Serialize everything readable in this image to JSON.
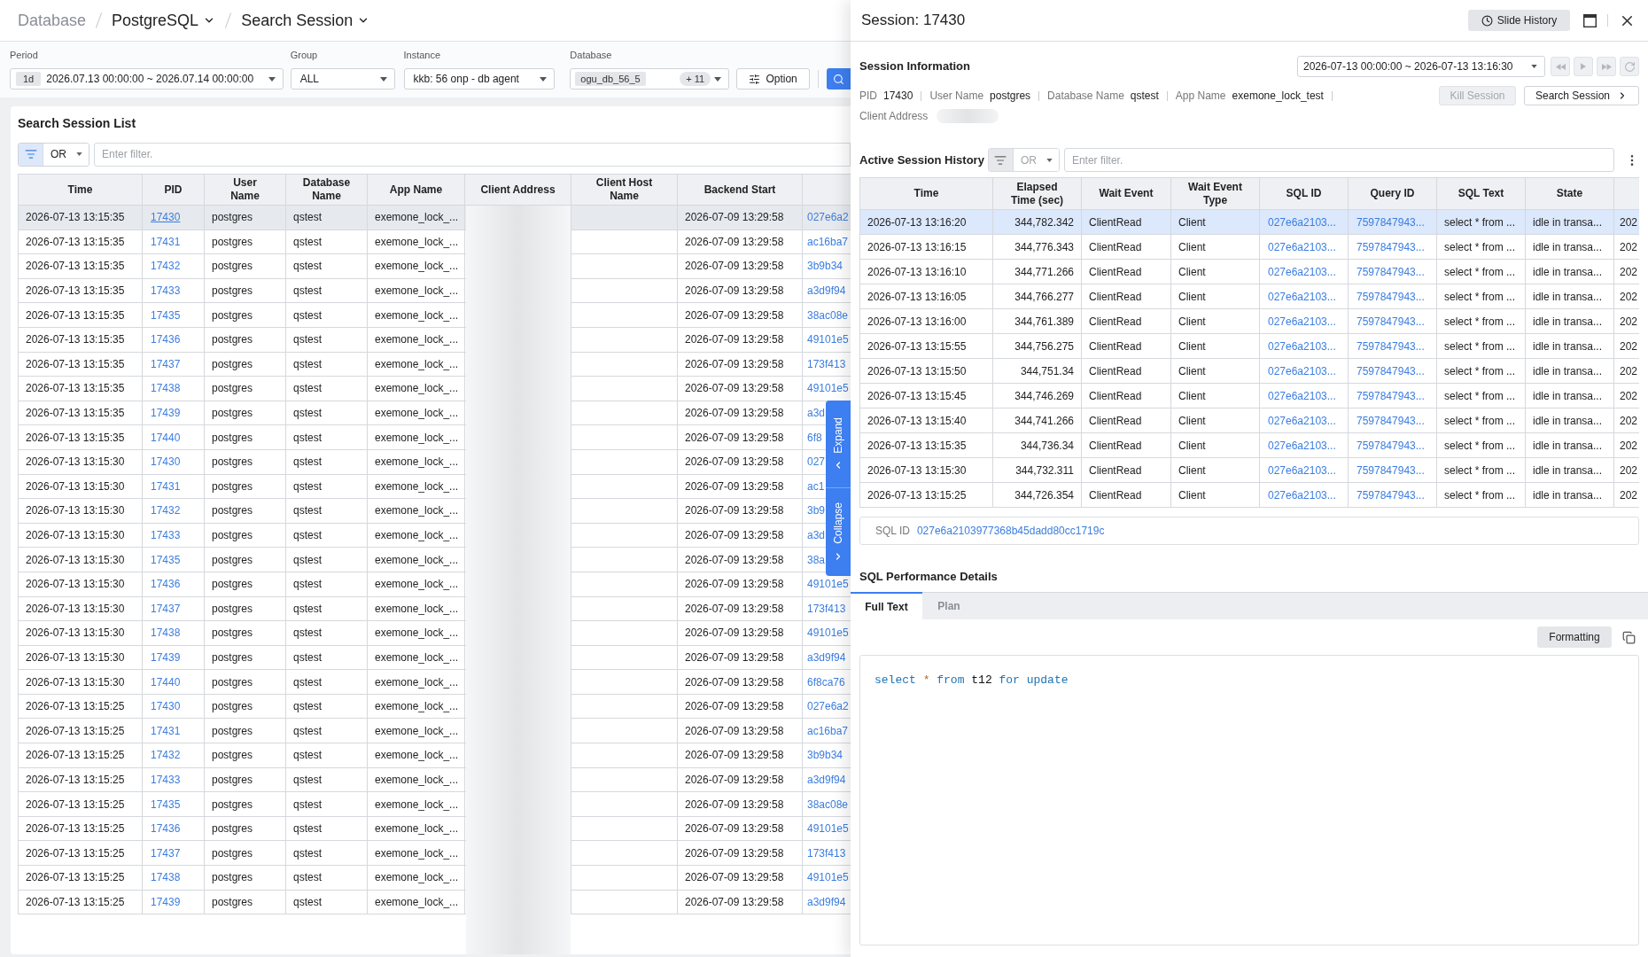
{
  "breadcrumb": [
    {
      "label": "Database",
      "dropdown": false
    },
    {
      "label": "PostgreSQL",
      "dropdown": true
    },
    {
      "label": "Search Session",
      "dropdown": true
    }
  ],
  "filters": {
    "period": {
      "label": "Period",
      "badge": "1d",
      "value": "2026.07.13 00:00:00 ~ 2026.07.14 00:00:00"
    },
    "group": {
      "label": "Group",
      "value": "ALL"
    },
    "instance": {
      "label": "Instance",
      "value": "kkb: 56 onp - db agent"
    },
    "database": {
      "label": "Database",
      "chip": "ogu_db_56_5",
      "more": "+ 11"
    },
    "option": "Option"
  },
  "session_list": {
    "title": "Search Session List",
    "filter": {
      "operator": "OR",
      "placeholder": "Enter filter.",
      "disabled": false
    },
    "columns": [
      "Time",
      "PID",
      "User Name",
      "Database Name",
      "App Name",
      "Client Address",
      "Client Host Name",
      "Backend Start"
    ],
    "rows": [
      {
        "time": "2026-07-13 13:15:35",
        "pid": "17430",
        "user_name": "postgres",
        "database_name": "qstest",
        "app_name": "exemone_lock_...",
        "backend_start": "2026-07-09 13:29:58",
        "column_9": "027e6a2",
        "selected": true
      },
      {
        "time": "2026-07-13 13:15:35",
        "pid": "17431",
        "user_name": "postgres",
        "database_name": "qstest",
        "app_name": "exemone_lock_...",
        "backend_start": "2026-07-09 13:29:58",
        "column_9": "ac16ba7",
        "selected": false
      },
      {
        "time": "2026-07-13 13:15:35",
        "pid": "17432",
        "user_name": "postgres",
        "database_name": "qstest",
        "app_name": "exemone_lock_...",
        "backend_start": "2026-07-09 13:29:58",
        "column_9": "3b9b34",
        "selected": false
      },
      {
        "time": "2026-07-13 13:15:35",
        "pid": "17433",
        "user_name": "postgres",
        "database_name": "qstest",
        "app_name": "exemone_lock_...",
        "backend_start": "2026-07-09 13:29:58",
        "column_9": "a3d9f94",
        "selected": false
      },
      {
        "time": "2026-07-13 13:15:35",
        "pid": "17435",
        "user_name": "postgres",
        "database_name": "qstest",
        "app_name": "exemone_lock_...",
        "backend_start": "2026-07-09 13:29:58",
        "column_9": "38ac08e",
        "selected": false
      },
      {
        "time": "2026-07-13 13:15:35",
        "pid": "17436",
        "user_name": "postgres",
        "database_name": "qstest",
        "app_name": "exemone_lock_...",
        "backend_start": "2026-07-09 13:29:58",
        "column_9": "49101e5",
        "selected": false
      },
      {
        "time": "2026-07-13 13:15:35",
        "pid": "17437",
        "user_name": "postgres",
        "database_name": "qstest",
        "app_name": "exemone_lock_...",
        "backend_start": "2026-07-09 13:29:58",
        "column_9": "173f413",
        "selected": false
      },
      {
        "time": "2026-07-13 13:15:35",
        "pid": "17438",
        "user_name": "postgres",
        "database_name": "qstest",
        "app_name": "exemone_lock_...",
        "backend_start": "2026-07-09 13:29:58",
        "column_9": "49101e5",
        "selected": false
      },
      {
        "time": "2026-07-13 13:15:35",
        "pid": "17439",
        "user_name": "postgres",
        "database_name": "qstest",
        "app_name": "exemone_lock_...",
        "backend_start": "2026-07-09 13:29:58",
        "column_9": "a3d",
        "selected": false
      },
      {
        "time": "2026-07-13 13:15:35",
        "pid": "17440",
        "user_name": "postgres",
        "database_name": "qstest",
        "app_name": "exemone_lock_...",
        "backend_start": "2026-07-09 13:29:58",
        "column_9": "6f8",
        "selected": false
      },
      {
        "time": "2026-07-13 13:15:30",
        "pid": "17430",
        "user_name": "postgres",
        "database_name": "qstest",
        "app_name": "exemone_lock_...",
        "backend_start": "2026-07-09 13:29:58",
        "column_9": "027",
        "selected": false
      },
      {
        "time": "2026-07-13 13:15:30",
        "pid": "17431",
        "user_name": "postgres",
        "database_name": "qstest",
        "app_name": "exemone_lock_...",
        "backend_start": "2026-07-09 13:29:58",
        "column_9": "ac1",
        "selected": false
      },
      {
        "time": "2026-07-13 13:15:30",
        "pid": "17432",
        "user_name": "postgres",
        "database_name": "qstest",
        "app_name": "exemone_lock_...",
        "backend_start": "2026-07-09 13:29:58",
        "column_9": "3b9",
        "selected": false
      },
      {
        "time": "2026-07-13 13:15:30",
        "pid": "17433",
        "user_name": "postgres",
        "database_name": "qstest",
        "app_name": "exemone_lock_...",
        "backend_start": "2026-07-09 13:29:58",
        "column_9": "a3d",
        "selected": false
      },
      {
        "time": "2026-07-13 13:15:30",
        "pid": "17435",
        "user_name": "postgres",
        "database_name": "qstest",
        "app_name": "exemone_lock_...",
        "backend_start": "2026-07-09 13:29:58",
        "column_9": "38a",
        "selected": false
      },
      {
        "time": "2026-07-13 13:15:30",
        "pid": "17436",
        "user_name": "postgres",
        "database_name": "qstest",
        "app_name": "exemone_lock_...",
        "backend_start": "2026-07-09 13:29:58",
        "column_9": "49101e5",
        "selected": false
      },
      {
        "time": "2026-07-13 13:15:30",
        "pid": "17437",
        "user_name": "postgres",
        "database_name": "qstest",
        "app_name": "exemone_lock_...",
        "backend_start": "2026-07-09 13:29:58",
        "column_9": "173f413",
        "selected": false
      },
      {
        "time": "2026-07-13 13:15:30",
        "pid": "17438",
        "user_name": "postgres",
        "database_name": "qstest",
        "app_name": "exemone_lock_...",
        "backend_start": "2026-07-09 13:29:58",
        "column_9": "49101e5",
        "selected": false
      },
      {
        "time": "2026-07-13 13:15:30",
        "pid": "17439",
        "user_name": "postgres",
        "database_name": "qstest",
        "app_name": "exemone_lock_...",
        "backend_start": "2026-07-09 13:29:58",
        "column_9": "a3d9f94",
        "selected": false
      },
      {
        "time": "2026-07-13 13:15:30",
        "pid": "17440",
        "user_name": "postgres",
        "database_name": "qstest",
        "app_name": "exemone_lock_...",
        "backend_start": "2026-07-09 13:29:58",
        "column_9": "6f8ca76",
        "selected": false
      },
      {
        "time": "2026-07-13 13:15:25",
        "pid": "17430",
        "user_name": "postgres",
        "database_name": "qstest",
        "app_name": "exemone_lock_...",
        "backend_start": "2026-07-09 13:29:58",
        "column_9": "027e6a2",
        "selected": false
      },
      {
        "time": "2026-07-13 13:15:25",
        "pid": "17431",
        "user_name": "postgres",
        "database_name": "qstest",
        "app_name": "exemone_lock_...",
        "backend_start": "2026-07-09 13:29:58",
        "column_9": "ac16ba7",
        "selected": false
      },
      {
        "time": "2026-07-13 13:15:25",
        "pid": "17432",
        "user_name": "postgres",
        "database_name": "qstest",
        "app_name": "exemone_lock_...",
        "backend_start": "2026-07-09 13:29:58",
        "column_9": "3b9b34",
        "selected": false
      },
      {
        "time": "2026-07-13 13:15:25",
        "pid": "17433",
        "user_name": "postgres",
        "database_name": "qstest",
        "app_name": "exemone_lock_...",
        "backend_start": "2026-07-09 13:29:58",
        "column_9": "a3d9f94",
        "selected": false
      },
      {
        "time": "2026-07-13 13:15:25",
        "pid": "17435",
        "user_name": "postgres",
        "database_name": "qstest",
        "app_name": "exemone_lock_...",
        "backend_start": "2026-07-09 13:29:58",
        "column_9": "38ac08e",
        "selected": false
      },
      {
        "time": "2026-07-13 13:15:25",
        "pid": "17436",
        "user_name": "postgres",
        "database_name": "qstest",
        "app_name": "exemone_lock_...",
        "backend_start": "2026-07-09 13:29:58",
        "column_9": "49101e5",
        "selected": false
      },
      {
        "time": "2026-07-13 13:15:25",
        "pid": "17437",
        "user_name": "postgres",
        "database_name": "qstest",
        "app_name": "exemone_lock_...",
        "backend_start": "2026-07-09 13:29:58",
        "column_9": "173f413",
        "selected": false
      },
      {
        "time": "2026-07-13 13:15:25",
        "pid": "17438",
        "user_name": "postgres",
        "database_name": "qstest",
        "app_name": "exemone_lock_...",
        "backend_start": "2026-07-09 13:29:58",
        "column_9": "49101e5",
        "selected": false
      },
      {
        "time": "2026-07-13 13:15:25",
        "pid": "17439",
        "user_name": "postgres",
        "database_name": "qstest",
        "app_name": "exemone_lock_...",
        "backend_start": "2026-07-09 13:29:58",
        "column_9": "a3d9f94",
        "selected": false
      }
    ]
  },
  "side_tab": {
    "expand": "Expand",
    "collapse": "Collapse"
  },
  "drawer": {
    "title": "Session: 17430",
    "slide_history": "Slide History",
    "info": {
      "title": "Session Information",
      "range": "2026-07-13 00:00:00 ~ 2026-07-13 13:16:30",
      "playback": [
        {
          "kind": "rewind",
          "disabled": true
        },
        {
          "kind": "play",
          "disabled": true
        },
        {
          "kind": "forward",
          "disabled": true
        },
        {
          "kind": "refresh",
          "disabled": true
        }
      ],
      "fields": [
        {
          "label": "PID",
          "value": "17430"
        },
        {
          "label": "User Name",
          "value": "postgres"
        },
        {
          "label": "Database Name",
          "value": "qstest"
        },
        {
          "label": "App Name",
          "value": "exemone_lock_test"
        }
      ],
      "client_address": "Client Address",
      "actions": [
        {
          "label": "Kill Session",
          "kind": "action",
          "disabled": true
        },
        {
          "label": "Search Session",
          "kind": "navigate",
          "disabled": false
        }
      ]
    },
    "history": {
      "title": "Active Session History",
      "filter": {
        "operator": "OR",
        "placeholder": "Enter filter.",
        "disabled": true
      },
      "columns": [
        "Time",
        "Elapsed Time (sec)",
        "Wait Event",
        "Wait Event Type",
        "SQL ID",
        "Query ID",
        "SQL Text",
        "State"
      ],
      "rows": [
        {
          "time": "2026-07-13 13:16:20",
          "elapsed": "344,782.342",
          "wait_event": "ClientRead",
          "wait_event_type": "Client",
          "sql_id": "027e6a2103...",
          "query_id": "7597847943...",
          "sql_text": "select * from ...",
          "state": "idle in transa...",
          "column_9": "202",
          "selected": true
        },
        {
          "time": "2026-07-13 13:16:15",
          "elapsed": "344,776.343",
          "wait_event": "ClientRead",
          "wait_event_type": "Client",
          "sql_id": "027e6a2103...",
          "query_id": "7597847943...",
          "sql_text": "select * from ...",
          "state": "idle in transa...",
          "column_9": "202",
          "selected": false
        },
        {
          "time": "2026-07-13 13:16:10",
          "elapsed": "344,771.266",
          "wait_event": "ClientRead",
          "wait_event_type": "Client",
          "sql_id": "027e6a2103...",
          "query_id": "7597847943...",
          "sql_text": "select * from ...",
          "state": "idle in transa...",
          "column_9": "202",
          "selected": false
        },
        {
          "time": "2026-07-13 13:16:05",
          "elapsed": "344,766.277",
          "wait_event": "ClientRead",
          "wait_event_type": "Client",
          "sql_id": "027e6a2103...",
          "query_id": "7597847943...",
          "sql_text": "select * from ...",
          "state": "idle in transa...",
          "column_9": "202",
          "selected": false
        },
        {
          "time": "2026-07-13 13:16:00",
          "elapsed": "344,761.389",
          "wait_event": "ClientRead",
          "wait_event_type": "Client",
          "sql_id": "027e6a2103...",
          "query_id": "7597847943...",
          "sql_text": "select * from ...",
          "state": "idle in transa...",
          "column_9": "202",
          "selected": false
        },
        {
          "time": "2026-07-13 13:15:55",
          "elapsed": "344,756.275",
          "wait_event": "ClientRead",
          "wait_event_type": "Client",
          "sql_id": "027e6a2103...",
          "query_id": "7597847943...",
          "sql_text": "select * from ...",
          "state": "idle in transa...",
          "column_9": "202",
          "selected": false
        },
        {
          "time": "2026-07-13 13:15:50",
          "elapsed": "344,751.34",
          "wait_event": "ClientRead",
          "wait_event_type": "Client",
          "sql_id": "027e6a2103...",
          "query_id": "7597847943...",
          "sql_text": "select * from ...",
          "state": "idle in transa...",
          "column_9": "202",
          "selected": false
        },
        {
          "time": "2026-07-13 13:15:45",
          "elapsed": "344,746.269",
          "wait_event": "ClientRead",
          "wait_event_type": "Client",
          "sql_id": "027e6a2103...",
          "query_id": "7597847943...",
          "sql_text": "select * from ...",
          "state": "idle in transa...",
          "column_9": "202",
          "selected": false
        },
        {
          "time": "2026-07-13 13:15:40",
          "elapsed": "344,741.266",
          "wait_event": "ClientRead",
          "wait_event_type": "Client",
          "sql_id": "027e6a2103...",
          "query_id": "7597847943...",
          "sql_text": "select * from ...",
          "state": "idle in transa...",
          "column_9": "202",
          "selected": false
        },
        {
          "time": "2026-07-13 13:15:35",
          "elapsed": "344,736.34",
          "wait_event": "ClientRead",
          "wait_event_type": "Client",
          "sql_id": "027e6a2103...",
          "query_id": "7597847943...",
          "sql_text": "select * from ...",
          "state": "idle in transa...",
          "column_9": "202",
          "selected": false
        },
        {
          "time": "2026-07-13 13:15:30",
          "elapsed": "344,732.311",
          "wait_event": "ClientRead",
          "wait_event_type": "Client",
          "sql_id": "027e6a2103...",
          "query_id": "7597847943...",
          "sql_text": "select * from ...",
          "state": "idle in transa...",
          "column_9": "202",
          "selected": false
        },
        {
          "time": "2026-07-13 13:15:25",
          "elapsed": "344,726.354",
          "wait_event": "ClientRead",
          "wait_event_type": "Client",
          "sql_id": "027e6a2103...",
          "query_id": "7597847943...",
          "sql_text": "select * from ...",
          "state": "idle in transa...",
          "column_9": "202",
          "selected": false
        }
      ]
    },
    "sql_id": {
      "label": "SQL ID",
      "value": "027e6a2103977368b45dadd80cc1719c"
    },
    "performance": {
      "title": "SQL Performance Details",
      "tabs": [
        {
          "label": "Full Text",
          "selected": true
        },
        {
          "label": "Plan",
          "selected": false
        }
      ],
      "formatting": "Formatting",
      "code": [
        {
          "text": "select",
          "kind": "keyword"
        },
        {
          "text": "*",
          "kind": "operator"
        },
        {
          "text": "from",
          "kind": "keyword"
        },
        {
          "text": "t12",
          "kind": "identifier"
        },
        {
          "text": "for",
          "kind": "keyword"
        },
        {
          "text": "update",
          "kind": "keyword"
        }
      ]
    }
  }
}
